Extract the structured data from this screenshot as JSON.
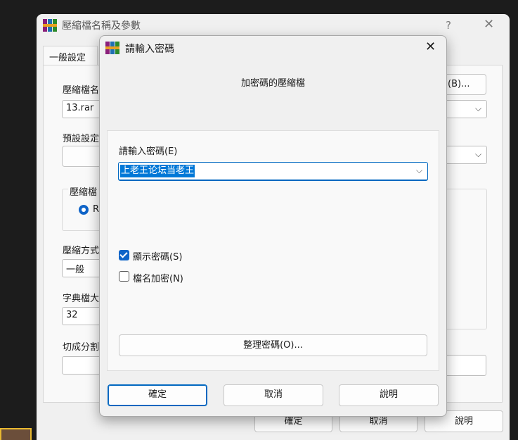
{
  "background_window": {
    "title": "壓縮檔名稱及參數",
    "help_glyph": "?",
    "close_glyph": "✕",
    "tab_general": "一般設定",
    "archive_name_label": "壓縮檔名",
    "archive_name_value": "13.rar",
    "browse_button": "(B)...",
    "profile_label": "預設設定",
    "format_group_label": "壓縮檔",
    "format_rar_label": "R",
    "method_label": "壓縮方式",
    "method_value": "一般",
    "dict_label": "字典檔大",
    "dict_value": "32",
    "split_label": "切成分割",
    "ok_button": "確定",
    "cancel_button": "取消",
    "help_button": "說明"
  },
  "dialog": {
    "title": "請輸入密碼",
    "close_glyph": "✕",
    "heading": "加密碼的壓縮檔",
    "password_label": "請輸入密碼(E)",
    "password_value": "上老王论坛当老王",
    "dropdown_glyph": "⌵",
    "show_password": {
      "label": "顯示密碼(S)",
      "checked": true
    },
    "encrypt_filenames": {
      "label": "檔名加密(N)",
      "checked": false
    },
    "organize_button": "整理密碼(O)...",
    "ok_button": "確定",
    "cancel_button": "取消",
    "help_button": "說明"
  },
  "icons": {
    "app_icon": "winrar-books-icon",
    "accent_color": "#0067c0"
  }
}
